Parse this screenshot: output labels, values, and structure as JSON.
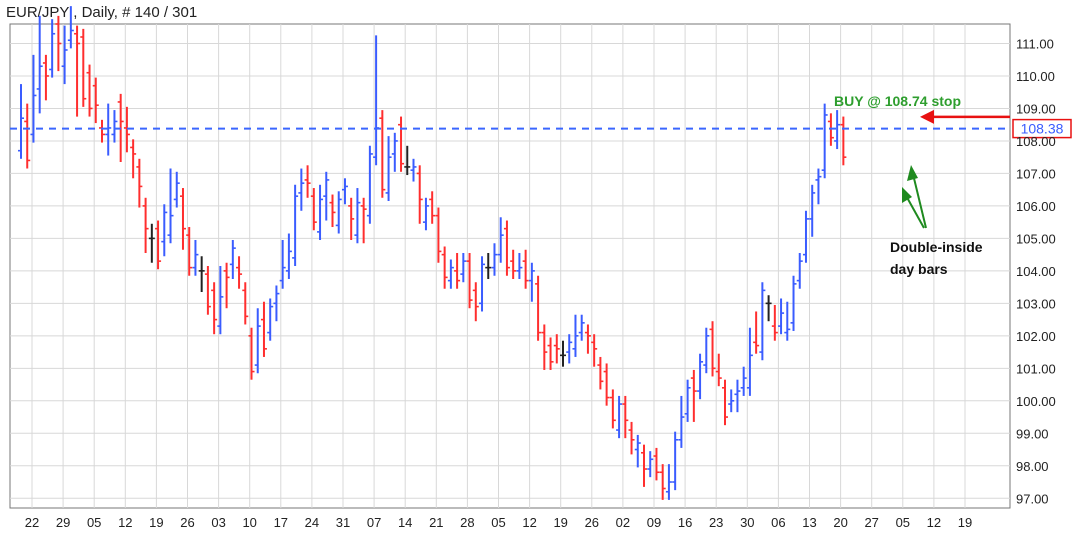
{
  "chart_data": {
    "type": "ohlc",
    "title": "EUR/JPY , Daily, # 140 / 301",
    "ylim": [
      96.7,
      111.6
    ],
    "y_ticks": [
      "97.00",
      "98.00",
      "99.00",
      "100.00",
      "101.00",
      "102.00",
      "103.00",
      "104.00",
      "105.00",
      "106.00",
      "107.00",
      "108.00",
      "109.00",
      "110.00",
      "111.00"
    ],
    "x_ticks": [
      "22",
      "29",
      "05",
      "12",
      "19",
      "26",
      "03",
      "10",
      "17",
      "24",
      "31",
      "07",
      "14",
      "21",
      "28",
      "05",
      "12",
      "19",
      "26",
      "02",
      "09",
      "16",
      "23",
      "30",
      "06",
      "13",
      "20",
      "27",
      "05",
      "12",
      "19"
    ],
    "grid": true,
    "bars": [
      [
        107.7,
        108.5,
        109.5,
        108.7
      ],
      [
        108.6,
        107.6,
        108.9,
        107.4
      ],
      [
        108.2,
        110.4,
        110.3,
        109.4
      ],
      [
        109.6,
        109.1,
        111.6,
        110.3
      ],
      [
        110.4,
        110.4,
        109.5,
        110.0
      ],
      [
        110.2,
        110.5,
        111.5,
        111.3
      ],
      [
        111.6,
        110.4,
        111.4,
        111.0
      ],
      [
        110.3,
        110.0,
        111.3,
        110.8
      ],
      [
        111.1,
        111.9,
        111.3,
        111.4
      ],
      [
        111.3,
        109.0,
        109.7,
        111.0
      ],
      [
        111.2,
        109.9,
        110.4,
        109.3
      ],
      [
        110.1,
        110.0,
        110.0,
        109.0
      ],
      [
        109.7,
        109.1,
        108.8,
        109.1
      ],
      [
        108.4,
        108.2,
        108.4,
        108.2
      ],
      [
        108.2,
        107.8,
        108.9,
        108.4
      ],
      [
        108.2,
        108.7,
        108.5,
        108.6
      ],
      [
        109.2,
        108.3,
        107.6,
        108.6
      ],
      [
        108.4,
        107.9,
        108.8,
        108.2
      ],
      [
        107.8,
        107.1,
        107.4,
        107.6
      ],
      [
        107.2,
        106.4,
        106.2,
        106.6
      ],
      [
        106.0,
        105.4,
        104.8,
        105.3
      ],
      [
        105.0,
        104.5,
        105.2,
        105.0
      ],
      [
        105.3,
        104.3,
        105.1,
        104.3
      ],
      [
        104.9,
        105.1,
        104.7,
        105.8
      ],
      [
        105.1,
        106.9,
        106.6,
        105.7
      ],
      [
        106.2,
        106.5,
        106.8,
        106.7
      ],
      [
        106.3,
        105.1,
        104.9,
        105.3
      ],
      [
        105.1,
        104.4,
        104.9,
        104.1
      ],
      [
        104.1,
        104.5,
        104.7,
        104.5
      ],
      [
        104.0,
        103.6,
        104.2,
        104.0
      ],
      [
        103.9,
        103.2,
        103.6,
        102.9
      ],
      [
        103.4,
        102.3,
        102.7,
        102.5
      ],
      [
        102.3,
        103.6,
        103.9,
        103.2
      ],
      [
        104.0,
        103.1,
        103.9,
        103.8
      ],
      [
        104.2,
        104.0,
        104.3,
        104.7
      ],
      [
        104.1,
        103.7,
        104.2,
        103.9
      ],
      [
        103.4,
        103.1,
        103.1,
        102.6
      ],
      [
        102.0,
        101.8,
        101.4,
        100.9
      ],
      [
        101.1,
        101.9,
        102.6,
        102.3
      ],
      [
        102.5,
        102.8,
        102.6,
        101.6
      ],
      [
        102.1,
        102.6,
        102.7,
        102.9
      ],
      [
        103.0,
        102.7,
        103.1,
        103.3
      ],
      [
        103.7,
        104.3,
        104.7,
        104.1
      ],
      [
        104.0,
        104.5,
        104.9,
        104.6
      ],
      [
        104.4,
        106.3,
        106.4,
        106.3
      ],
      [
        106.4,
        106.9,
        106.1,
        106.7
      ],
      [
        106.8,
        107.0,
        106.5,
        106.7
      ],
      [
        106.3,
        106.1,
        105.7,
        105.5
      ],
      [
        105.2,
        106.1,
        106.4,
        106.2
      ],
      [
        106.3,
        106.2,
        105.8,
        106.8
      ],
      [
        106.1,
        105.6,
        105.8,
        105.8
      ],
      [
        105.4,
        105.5,
        105.8,
        106.2
      ],
      [
        106.5,
        106.3,
        106.4,
        106.6
      ],
      [
        106.0,
        105.3,
        105.2,
        105.6
      ],
      [
        105.1,
        106.2,
        106.3,
        106.1
      ],
      [
        106.0,
        105.4,
        105.1,
        105.9
      ],
      [
        105.7,
        107.2,
        107.4,
        107.6
      ],
      [
        107.5,
        108.1,
        111.0,
        108.4
      ],
      [
        108.7,
        106.5,
        107.4,
        106.5
      ],
      [
        106.4,
        107.8,
        107.9,
        107.5
      ],
      [
        107.6,
        108.0,
        107.3,
        108.0
      ],
      [
        108.5,
        107.6,
        108.1,
        107.3
      ],
      [
        107.2,
        107.3,
        107.6,
        107.2
      ],
      [
        107.1,
        107.1,
        107.0,
        107.2
      ],
      [
        107.0,
        106.0,
        105.7,
        106.2
      ],
      [
        105.5,
        105.9,
        105.9,
        106.0
      ],
      [
        106.2,
        106.1,
        105.8,
        105.7
      ],
      [
        105.7,
        104.5,
        105.1,
        104.6
      ],
      [
        104.5,
        104.0,
        103.7,
        103.8
      ],
      [
        103.7,
        103.8,
        103.8,
        104.1
      ],
      [
        104.0,
        104.2,
        104.3,
        103.7
      ],
      [
        103.9,
        104.2,
        104.3,
        104.3
      ],
      [
        104.3,
        103.4,
        103.9,
        103.1
      ],
      [
        103.4,
        103.1,
        102.7,
        102.9
      ],
      [
        103.0,
        103.3,
        103.6,
        104.2
      ],
      [
        104.1,
        104.0,
        104.3,
        104.1
      ],
      [
        104.1,
        104.6,
        104.6,
        104.5
      ],
      [
        104.5,
        105.0,
        105.4,
        105.1
      ],
      [
        105.3,
        104.5,
        104.7,
        104.1
      ],
      [
        104.3,
        104.4,
        104.0,
        104.0
      ],
      [
        104.0,
        104.3,
        104.2,
        104.1
      ],
      [
        104.3,
        103.8,
        104.4,
        103.7
      ],
      [
        103.7,
        103.3,
        103.7,
        104.0
      ],
      [
        103.6,
        102.8,
        102.3,
        102.1
      ],
      [
        102.1,
        101.8,
        101.2,
        101.5
      ],
      [
        101.7,
        101.5,
        101.6,
        101.2
      ],
      [
        101.7,
        101.4,
        101.8,
        101.6
      ],
      [
        101.4,
        101.3,
        101.6,
        101.4
      ],
      [
        101.5,
        101.4,
        101.5,
        101.8
      ],
      [
        101.6,
        102.1,
        102.4,
        102.0
      ],
      [
        102.1,
        102.2,
        102.2,
        102.4
      ],
      [
        102.1,
        101.7,
        101.8,
        102.0
      ],
      [
        101.8,
        101.3,
        101.8,
        101.6
      ],
      [
        101.1,
        100.8,
        101.0,
        100.6
      ],
      [
        100.9,
        100.5,
        100.8,
        100.1
      ],
      [
        100.1,
        99.7,
        99.5,
        99.4
      ],
      [
        99.1,
        99.5,
        99.9,
        99.9
      ],
      [
        99.9,
        99.1,
        99.1,
        99.4
      ],
      [
        99.1,
        98.6,
        98.7,
        98.8
      ],
      [
        98.5,
        98.4,
        98.2,
        98.7
      ],
      [
        98.4,
        97.6,
        98.2,
        97.9
      ],
      [
        97.9,
        98.0,
        98.1,
        98.2
      ],
      [
        98.3,
        98.1,
        98.1,
        97.8
      ],
      [
        97.8,
        97.2,
        97.4,
        97.3
      ],
      [
        97.2,
        97.8,
        97.2,
        97.5
      ],
      [
        97.5,
        98.2,
        98.4,
        98.8
      ],
      [
        98.8,
        99.6,
        99.9,
        99.5
      ],
      [
        99.6,
        99.8,
        99.6,
        100.4
      ],
      [
        100.7,
        99.6,
        100.4,
        100.3
      ],
      [
        100.3,
        100.4,
        101.2,
        101.2
      ],
      [
        101.1,
        101.7,
        101.8,
        102.0
      ],
      [
        102.2,
        101.5,
        101.2,
        101.0
      ],
      [
        100.9,
        101.2,
        101.0,
        100.7
      ],
      [
        100.4,
        99.8,
        99.9,
        99.5
      ],
      [
        99.9,
        100.1,
        99.9,
        100.0
      ],
      [
        100.2,
        99.9,
        100.4,
        100.3
      ],
      [
        100.4,
        100.4,
        100.8,
        100.7
      ],
      [
        100.4,
        101.2,
        102.0,
        101.4
      ],
      [
        101.8,
        102.3,
        102.5,
        101.7
      ],
      [
        101.5,
        102.3,
        102.7,
        103.4
      ],
      [
        103.0,
        102.7,
        102.8,
        103.0
      ],
      [
        102.3,
        102.3,
        102.7,
        102.1
      ],
      [
        102.3,
        102.4,
        102.9,
        102.7
      ],
      [
        102.1,
        102.5,
        102.8,
        102.2
      ],
      [
        102.4,
        103.1,
        103.3,
        103.6
      ],
      [
        103.7,
        104.3,
        104.3,
        104.3
      ],
      [
        104.5,
        105.1,
        105.3,
        105.6
      ],
      [
        105.6,
        105.6,
        105.3,
        106.4
      ],
      [
        106.8,
        106.5,
        106.3,
        106.9
      ],
      [
        107.1,
        108.2,
        108.9,
        108.8
      ],
      [
        108.6,
        108.3,
        108.2,
        108.1
      ],
      [
        108.0,
        108.7,
        108.5,
        108.5
      ],
      [
        108.5,
        107.8,
        107.8,
        107.5
      ]
    ],
    "buy_stop_price": 108.74,
    "current_price_label": "108.38",
    "current_price": 108.38,
    "annotations": {
      "buy": "BUY @ 108.74 stop",
      "note_line1": "Double-inside",
      "note_line2": "day bars"
    },
    "colors": {
      "up": "#3a5cff",
      "down": "#ff2e2e",
      "neutral": "#222222",
      "dashed_line": "#3a66ff",
      "buy_text": "#2e9e2e",
      "arrow_red": "#e81111",
      "arrow_green": "#1f8a1f",
      "grid": "#d8d8d8",
      "frame": "#777777"
    }
  }
}
